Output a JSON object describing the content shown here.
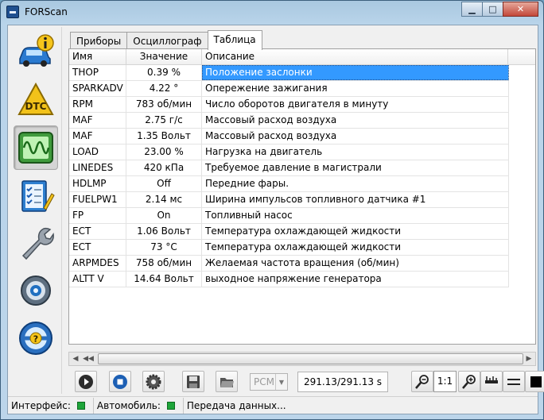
{
  "window": {
    "title": "FORScan",
    "min_label": "▁",
    "max_label": "□",
    "close_label": "✕"
  },
  "tabs": [
    {
      "label": "Приборы"
    },
    {
      "label": "Осциллограф"
    },
    {
      "label": "Таблица"
    }
  ],
  "table": {
    "headers": {
      "name": "Имя",
      "value": "Значение",
      "description": "Описание"
    },
    "rows": [
      {
        "name": "THOP",
        "value": "0.39 %",
        "description": "Положение заслонки"
      },
      {
        "name": "SPARKADV",
        "value": "4.22 °",
        "description": "Опережение зажигания"
      },
      {
        "name": "RPM",
        "value": "783 об/мин",
        "description": "Число оборотов двигателя в минуту"
      },
      {
        "name": "MAF",
        "value": "2.75 г/с",
        "description": "Массовый расход воздуха"
      },
      {
        "name": "MAF",
        "value": "1.35 Вольт",
        "description": "Массовый расход воздуха"
      },
      {
        "name": "LOAD",
        "value": "23.00 %",
        "description": "Нагрузка на двигатель"
      },
      {
        "name": "LINEDES",
        "value": "420 кПа",
        "description": "Требуемое давление в магистрали"
      },
      {
        "name": "HDLMP",
        "value": "Off",
        "description": "Передние фары."
      },
      {
        "name": "FUELPW1",
        "value": "2.14 мс",
        "description": "Ширина импульсов топливного датчика #1"
      },
      {
        "name": "FP",
        "value": "On",
        "description": "Топливный насос"
      },
      {
        "name": "ECT",
        "value": "1.06 Вольт",
        "description": "Температура охлаждающей жидкости"
      },
      {
        "name": "ECT",
        "value": "73 °C",
        "description": "Температура охлаждающей жидкости"
      },
      {
        "name": "ARPMDES",
        "value": "758 об/мин",
        "description": "Желаемая частота вращения (об/мин)"
      },
      {
        "name": "ALTT V",
        "value": "14.64 Вольт",
        "description": "выходное напряжение генератора"
      }
    ]
  },
  "toolbar": {
    "module_select": "PCM",
    "time_readout": "291.13/291.13 s",
    "zoom_ratio": "1:1"
  },
  "statusbar": {
    "interface_label": "Интерфейс:",
    "vehicle_label": "Автомобиль:",
    "transfer_label": "Передача данных..."
  },
  "colors": {
    "selection": "#3399ff",
    "status_led": "#1ea53a"
  }
}
